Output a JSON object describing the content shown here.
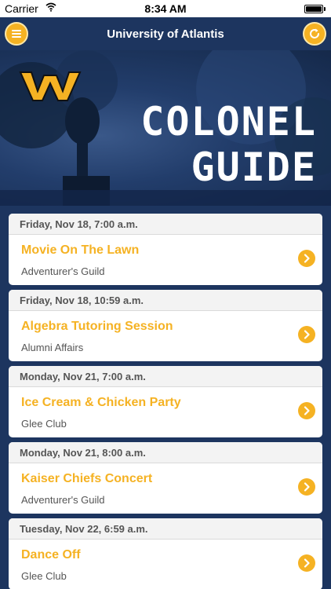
{
  "status_bar": {
    "carrier": "Carrier",
    "time": "8:34 AM",
    "battery_level": 1.0
  },
  "nav": {
    "title": "University of Atlantis",
    "menu_icon": "hamburger-icon",
    "refresh_icon": "refresh-icon"
  },
  "hero": {
    "title_line1": "COLONEL",
    "title_line2": "GUIDE",
    "logo_icon": "w-logo-icon"
  },
  "colors": {
    "accent": "#f5b223",
    "navy": "#1d355f"
  },
  "events": [
    {
      "date": "Friday, Nov 18, 7:00 a.m.",
      "name": "Movie On The Lawn",
      "organizer": "Adventurer's Guild"
    },
    {
      "date": "Friday, Nov 18, 10:59 a.m.",
      "name": "Algebra Tutoring Session",
      "organizer": "Alumni Affairs"
    },
    {
      "date": "Monday, Nov 21, 7:00 a.m.",
      "name": "Ice Cream & Chicken Party",
      "organizer": "Glee Club"
    },
    {
      "date": "Monday, Nov 21, 8:00 a.m.",
      "name": "Kaiser Chiefs Concert",
      "organizer": "Adventurer's Guild"
    },
    {
      "date": "Tuesday, Nov 22, 6:59 a.m.",
      "name": "Dance Off",
      "organizer": "Glee Club"
    }
  ]
}
